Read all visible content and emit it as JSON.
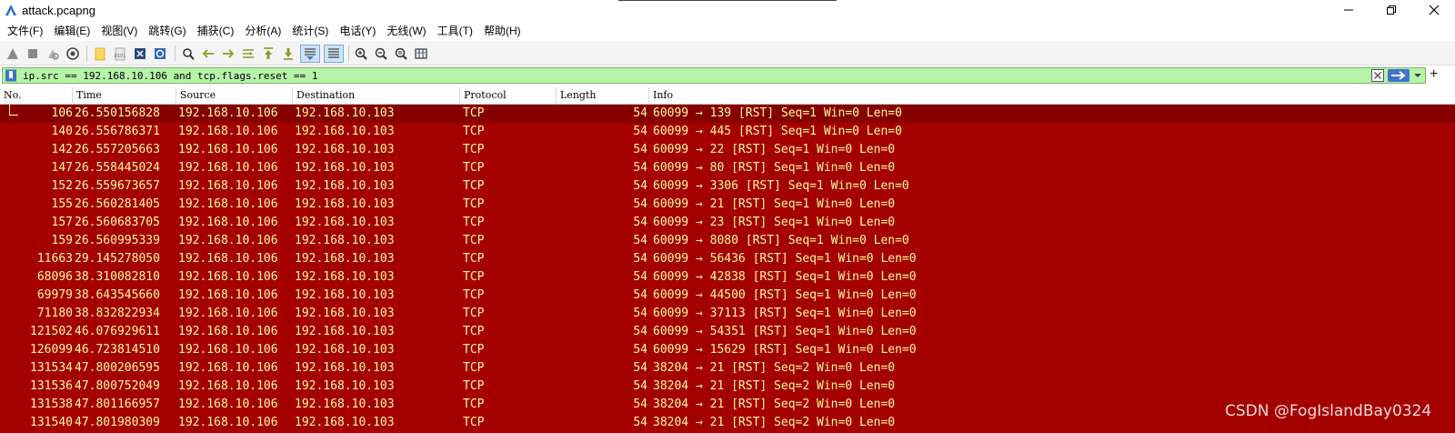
{
  "window": {
    "title": "attack.pcapng",
    "controls": [
      "minimize",
      "maximize",
      "close"
    ]
  },
  "menu": [
    {
      "label": "文件(F)"
    },
    {
      "label": "编辑(E)"
    },
    {
      "label": "视图(V)"
    },
    {
      "label": "跳转(G)"
    },
    {
      "label": "捕获(C)"
    },
    {
      "label": "分析(A)"
    },
    {
      "label": "统计(S)"
    },
    {
      "label": "电话(Y)"
    },
    {
      "label": "无线(W)"
    },
    {
      "label": "工具(T)"
    },
    {
      "label": "帮助(H)"
    }
  ],
  "toolbar": {
    "icons": [
      "start-capture-icon",
      "stop-capture-icon",
      "restart-capture-icon",
      "capture-options-icon",
      "open-file-icon",
      "save-file-icon",
      "close-file-icon",
      "reload-file-icon",
      "find-packet-icon",
      "go-back-icon",
      "go-forward-icon",
      "go-to-packet-icon",
      "go-first-icon",
      "go-last-icon",
      "auto-scroll-icon",
      "colorize-icon",
      "zoom-in-icon",
      "zoom-out-icon",
      "normal-size-icon",
      "resize-columns-icon"
    ]
  },
  "filter": {
    "value": "ip.src == 192.168.10.106 and tcp.flags.reset == 1",
    "valid": true,
    "color": "#b5f3a9"
  },
  "columns": {
    "no": "No.",
    "time": "Time",
    "source": "Source",
    "destination": "Destination",
    "protocol": "Protocol",
    "length": "Length",
    "info": "Info"
  },
  "colors": {
    "row_bg": "#a40000",
    "row_fg": "#fffc9c",
    "selected_bg": "#860000"
  },
  "packets": [
    {
      "no": "106",
      "time": "26.550156828",
      "src": "192.168.10.106",
      "dst": "192.168.10.103",
      "proto": "TCP",
      "len": "54",
      "info": "60099 → 139 [RST] Seq=1 Win=0 Len=0"
    },
    {
      "no": "140",
      "time": "26.556786371",
      "src": "192.168.10.106",
      "dst": "192.168.10.103",
      "proto": "TCP",
      "len": "54",
      "info": "60099 → 445 [RST] Seq=1 Win=0 Len=0"
    },
    {
      "no": "142",
      "time": "26.557205663",
      "src": "192.168.10.106",
      "dst": "192.168.10.103",
      "proto": "TCP",
      "len": "54",
      "info": "60099 → 22 [RST] Seq=1 Win=0 Len=0"
    },
    {
      "no": "147",
      "time": "26.558445024",
      "src": "192.168.10.106",
      "dst": "192.168.10.103",
      "proto": "TCP",
      "len": "54",
      "info": "60099 → 80 [RST] Seq=1 Win=0 Len=0"
    },
    {
      "no": "152",
      "time": "26.559673657",
      "src": "192.168.10.106",
      "dst": "192.168.10.103",
      "proto": "TCP",
      "len": "54",
      "info": "60099 → 3306 [RST] Seq=1 Win=0 Len=0"
    },
    {
      "no": "155",
      "time": "26.560281405",
      "src": "192.168.10.106",
      "dst": "192.168.10.103",
      "proto": "TCP",
      "len": "54",
      "info": "60099 → 21 [RST] Seq=1 Win=0 Len=0"
    },
    {
      "no": "157",
      "time": "26.560683705",
      "src": "192.168.10.106",
      "dst": "192.168.10.103",
      "proto": "TCP",
      "len": "54",
      "info": "60099 → 23 [RST] Seq=1 Win=0 Len=0"
    },
    {
      "no": "159",
      "time": "26.560995339",
      "src": "192.168.10.106",
      "dst": "192.168.10.103",
      "proto": "TCP",
      "len": "54",
      "info": "60099 → 8080 [RST] Seq=1 Win=0 Len=0"
    },
    {
      "no": "11663",
      "time": "29.145278050",
      "src": "192.168.10.106",
      "dst": "192.168.10.103",
      "proto": "TCP",
      "len": "54",
      "info": "60099 → 56436 [RST] Seq=1 Win=0 Len=0"
    },
    {
      "no": "68096",
      "time": "38.310082810",
      "src": "192.168.10.106",
      "dst": "192.168.10.103",
      "proto": "TCP",
      "len": "54",
      "info": "60099 → 42838 [RST] Seq=1 Win=0 Len=0"
    },
    {
      "no": "69979",
      "time": "38.643545660",
      "src": "192.168.10.106",
      "dst": "192.168.10.103",
      "proto": "TCP",
      "len": "54",
      "info": "60099 → 44500 [RST] Seq=1 Win=0 Len=0"
    },
    {
      "no": "71180",
      "time": "38.832822934",
      "src": "192.168.10.106",
      "dst": "192.168.10.103",
      "proto": "TCP",
      "len": "54",
      "info": "60099 → 37113 [RST] Seq=1 Win=0 Len=0"
    },
    {
      "no": "121502",
      "time": "46.076929611",
      "src": "192.168.10.106",
      "dst": "192.168.10.103",
      "proto": "TCP",
      "len": "54",
      "info": "60099 → 54351 [RST] Seq=1 Win=0 Len=0"
    },
    {
      "no": "126099",
      "time": "46.723814510",
      "src": "192.168.10.106",
      "dst": "192.168.10.103",
      "proto": "TCP",
      "len": "54",
      "info": "60099 → 15629 [RST] Seq=1 Win=0 Len=0"
    },
    {
      "no": "131534",
      "time": "47.800206595",
      "src": "192.168.10.106",
      "dst": "192.168.10.103",
      "proto": "TCP",
      "len": "54",
      "info": "38204 → 21 [RST] Seq=2 Win=0 Len=0"
    },
    {
      "no": "131536",
      "time": "47.800752049",
      "src": "192.168.10.106",
      "dst": "192.168.10.103",
      "proto": "TCP",
      "len": "54",
      "info": "38204 → 21 [RST] Seq=2 Win=0 Len=0"
    },
    {
      "no": "131538",
      "time": "47.801166957",
      "src": "192.168.10.106",
      "dst": "192.168.10.103",
      "proto": "TCP",
      "len": "54",
      "info": "38204 → 21 [RST] Seq=2 Win=0 Len=0"
    },
    {
      "no": "131540",
      "time": "47.801980309",
      "src": "192.168.10.106",
      "dst": "192.168.10.103",
      "proto": "TCP",
      "len": "54",
      "info": "38204 → 21 [RST] Seq=2 Win=0 Len=0"
    }
  ],
  "selected_packet": "106",
  "watermark": "CSDN @FogIslandBay0324"
}
